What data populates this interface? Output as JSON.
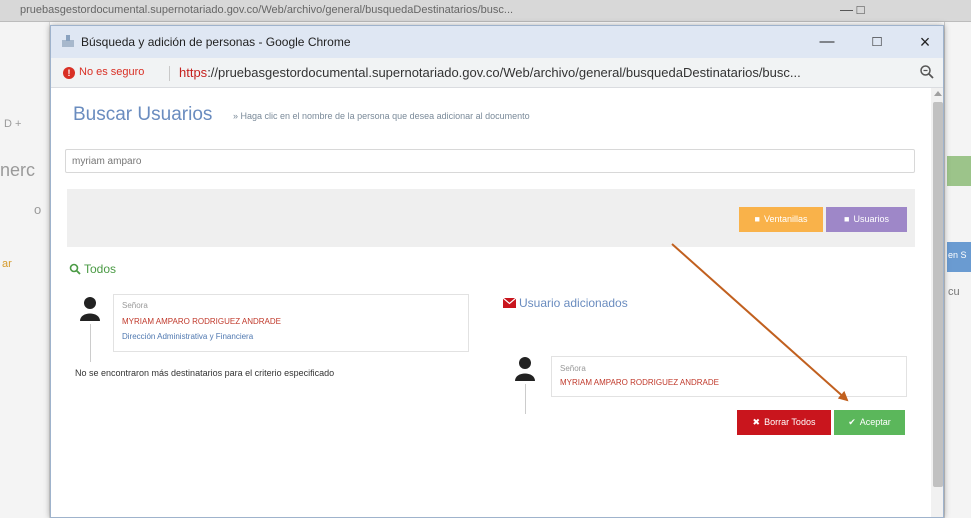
{
  "background_page": {
    "top_text": "pruebasgestordocumental.supernotariado.gov.co/Web/archivo/general/busquedaDestinatarios/busc...",
    "window_controls": "—   □",
    "left_fragments": [
      "D +",
      "nerc",
      "o",
      "ar"
    ],
    "right_fragments": [
      "en S",
      "cu"
    ]
  },
  "window": {
    "title": "Búsqueda y adición de personas - Google Chrome",
    "minimize": "—",
    "maximize": "□",
    "close": "×"
  },
  "address_bar": {
    "security_warning": "No es seguro",
    "url_scheme": "https",
    "url_rest": "://pruebasgestordocumental.supernotariado.gov.co/Web/archivo/general/busquedaDestinatarios/busc...",
    "zoom_icon": "zoom-icon"
  },
  "search_panel": {
    "title": "Buscar Usuarios",
    "hint": "» Haga clic en el nombre de la persona que desea adicionar al documento",
    "query": "myriam amparo",
    "buttons": {
      "ventanillas": "Ventanillas",
      "usuarios": "Usuarios"
    }
  },
  "results": {
    "section_title": "Todos",
    "person": {
      "title": "Señora",
      "name": "MYRIAM AMPARO RODRIGUEZ ANDRADE",
      "department": "Dirección Administrativa y Financiera"
    },
    "no_more": "No se encontraron más destinatarios para el criterio especificado"
  },
  "added": {
    "section_title": "Usuario adicionados",
    "person": {
      "title": "Señora",
      "name": "MYRIAM AMPARO RODRIGUEZ ANDRADE"
    },
    "buttons": {
      "borrar": "Borrar Todos",
      "aceptar": "Aceptar"
    }
  },
  "colors": {
    "heading_blue": "#6a8cbf",
    "ventanillas_orange": "#f9b24a",
    "usuarios_purple": "#9e87c8",
    "borrar_red": "#c9151d",
    "aceptar_green": "#5bb75b",
    "annotation_arrow": "#c1601f"
  }
}
